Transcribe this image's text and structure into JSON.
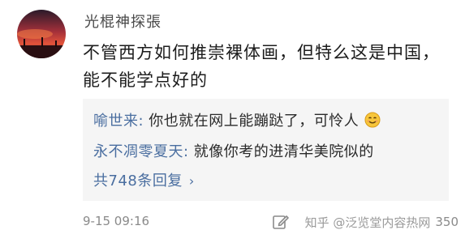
{
  "comment": {
    "username": "光棍神探張",
    "text": "不管西方如何推崇裸体画，但特么这是中国，能不能学点好的",
    "time": "9-15 09:16",
    "like_count": "350"
  },
  "replies": [
    {
      "name": "喻世来",
      "sep": ": ",
      "text": "你也就在网上能蹦跶了，可怜人",
      "emoji": "smile-emoji"
    },
    {
      "name": "永不凋零夏天",
      "sep": ": ",
      "text": "就像你考的进清华美院似的"
    }
  ],
  "more_replies": {
    "label": "共748条回复",
    "chevron": "›"
  },
  "watermark": "知乎 @泛览堂内容热网",
  "colors": {
    "link_blue": "#4a6ea0",
    "reply_bg": "#f5f5f5",
    "meta_gray": "#8a8a8a"
  },
  "icons": [
    "avatar-image",
    "smile-emoji",
    "edit-icon"
  ]
}
